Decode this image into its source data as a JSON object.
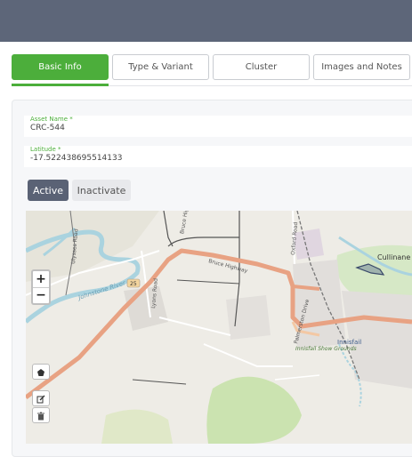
{
  "tabs": [
    {
      "label": "Basic Info"
    },
    {
      "label": "Type & Variant"
    },
    {
      "label": "Cluster"
    },
    {
      "label": "Images and Notes"
    }
  ],
  "fields": {
    "asset_name": {
      "label": "Asset Name *",
      "value": "CRC-544"
    },
    "latitude": {
      "label": "Latitude *",
      "value": "-17.522438695514133"
    }
  },
  "status": {
    "active_label": "Active",
    "inactive_label": "Inactivate"
  },
  "map": {
    "zoom_in": "+",
    "zoom_out": "−",
    "labels": {
      "bruce_highway_1": "Bruce Highway",
      "bruce_highway_2": "Bruce Highway",
      "johnstone_river": "Johnstone River",
      "lyons_road": "Lyons Road",
      "ulysses_road": "Ulysses Road",
      "oxford_road": "Oxford Road",
      "palmerston_drive": "Palmerston Drive",
      "innisfail": "Innisfail",
      "show_grounds": "Innisfail Show Grounds",
      "cullinane": "Cullinane",
      "route": "25"
    },
    "tools": [
      "polygon-icon",
      "edit-icon",
      "trash-icon"
    ]
  },
  "colors": {
    "accent": "#4cae3b",
    "topbar": "#5d6679",
    "active_button": "#5a6275",
    "highway": "#e8a283",
    "river": "#aad3df"
  }
}
